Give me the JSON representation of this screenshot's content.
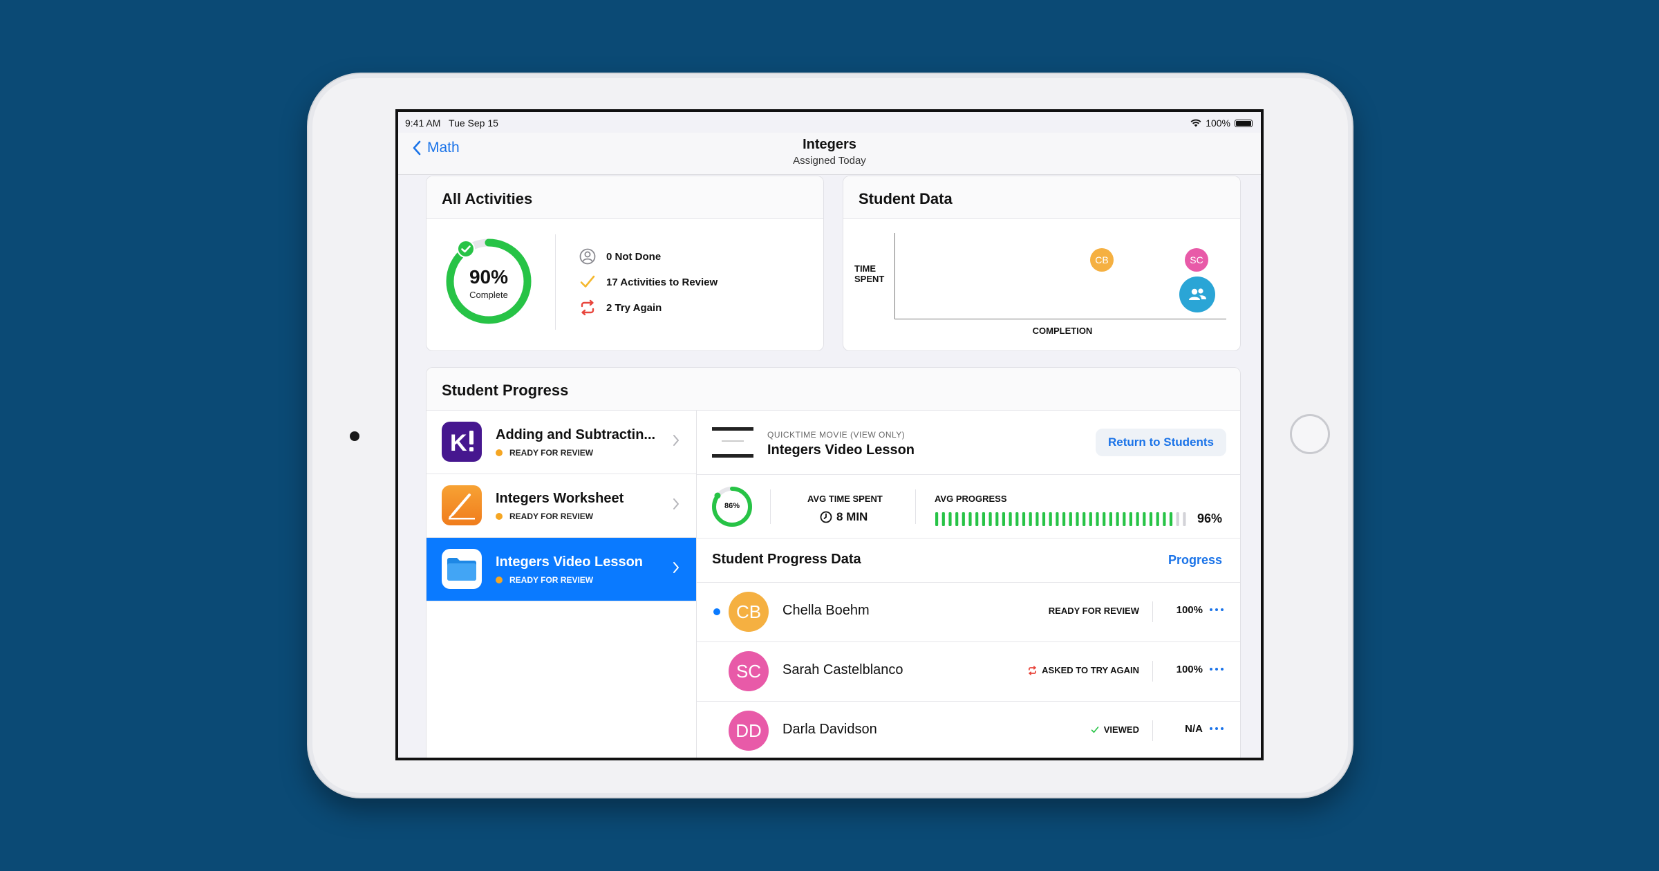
{
  "status_bar": {
    "time": "9:41 AM",
    "date": "Tue Sep 15",
    "battery": "100%"
  },
  "nav": {
    "back_label": "Math",
    "title": "Integers",
    "subtitle": "Assigned Today"
  },
  "all_activities": {
    "title": "All Activities",
    "complete_pct": "90%",
    "complete_label": "Complete",
    "complete_fraction": 0.9,
    "stats": [
      {
        "icon": "person-icon",
        "label": "0 Not Done"
      },
      {
        "icon": "checkmark-icon",
        "label": "17 Activities to Review"
      },
      {
        "icon": "try-again-icon",
        "label": "2 Try Again"
      }
    ]
  },
  "student_data": {
    "title": "Student Data",
    "y_label_line1": "TIME",
    "y_label_line2": "SPENT",
    "x_label": "COMPLETION",
    "points": [
      {
        "initials": "CB",
        "color": "#f5b041"
      },
      {
        "initials": "SC",
        "color": "#e85aa8"
      }
    ],
    "group_icon": "group-icon"
  },
  "student_progress": {
    "title": "Student Progress",
    "activities": [
      {
        "title": "Adding and Subtractin...",
        "status": "READY FOR REVIEW",
        "icon": "kahoot-icon",
        "selected": false
      },
      {
        "title": "Integers Worksheet",
        "status": "READY FOR REVIEW",
        "icon": "pages-icon",
        "selected": false
      },
      {
        "title": "Integers Video Lesson",
        "status": "READY FOR REVIEW",
        "icon": "files-icon",
        "selected": true
      }
    ],
    "detail": {
      "kind": "QUICKTIME MOVIE (VIEW ONLY)",
      "title": "Integers Video Lesson",
      "return_button": "Return to Students",
      "ring_pct": "86%",
      "ring_fraction": 0.86,
      "avg_time_label": "AVG TIME SPENT",
      "avg_time_value": "8 MIN",
      "avg_progress_label": "AVG PROGRESS",
      "avg_progress_value": "96%",
      "avg_progress_fraction": 0.96,
      "data_title": "Student Progress Data",
      "data_link": "Progress",
      "students": [
        {
          "initials": "CB",
          "name": "Chella Boehm",
          "status": "READY FOR REVIEW",
          "status_icon": "",
          "value": "100%",
          "color": "#f5b041",
          "unread": true
        },
        {
          "initials": "SC",
          "name": "Sarah Castelblanco",
          "status": "ASKED TO TRY AGAIN",
          "status_icon": "try-again-icon",
          "value": "100%",
          "color": "#e85aa8",
          "unread": false
        },
        {
          "initials": "DD",
          "name": "Darla Davidson",
          "status": "VIEWED",
          "status_icon": "checkmark-icon",
          "value": "N/A",
          "color": "#e85aa8",
          "unread": false
        }
      ]
    }
  }
}
